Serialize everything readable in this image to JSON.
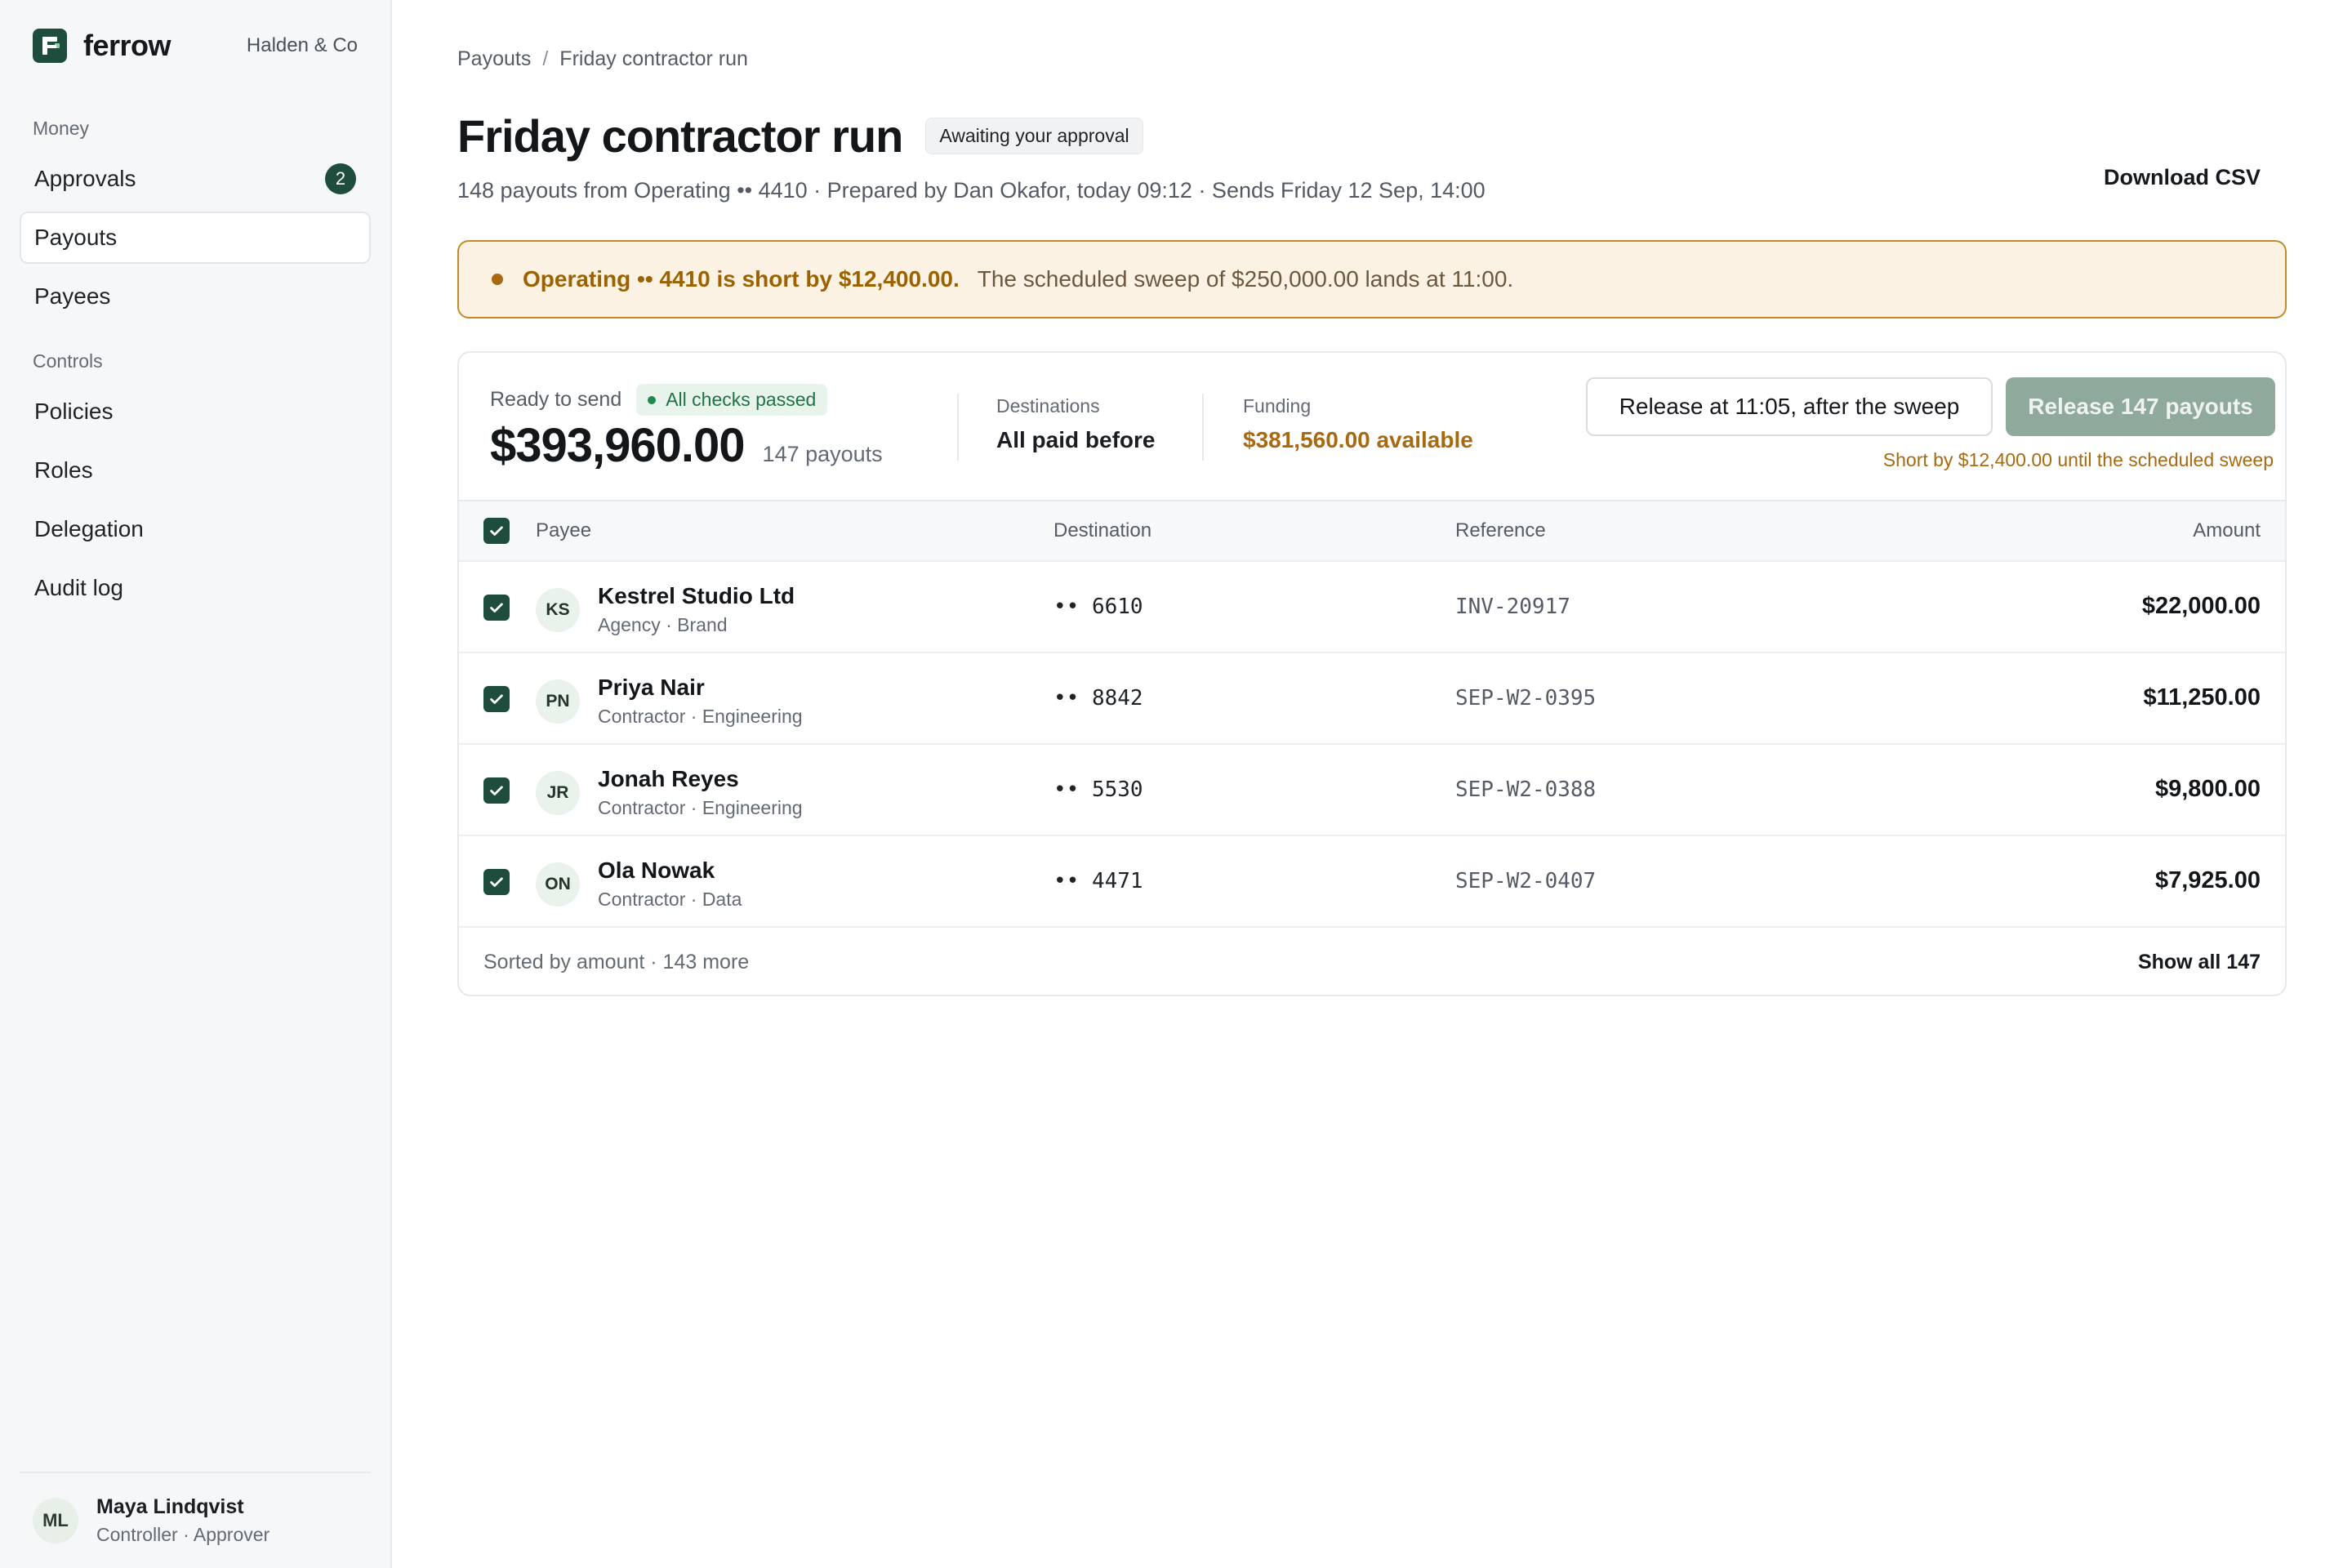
{
  "brand": {
    "name": "ferrow",
    "org": "Halden & Co",
    "logo_color": "#1f4d3d"
  },
  "sidebar": {
    "sections": [
      {
        "label": "Money",
        "items": [
          {
            "label": "Approvals",
            "badge": "2",
            "active": false
          },
          {
            "label": "Payouts",
            "active": true
          },
          {
            "label": "Payees",
            "active": false
          }
        ]
      },
      {
        "label": "Controls",
        "items": [
          {
            "label": "Policies"
          },
          {
            "label": "Roles"
          },
          {
            "label": "Delegation"
          },
          {
            "label": "Audit log"
          }
        ]
      }
    ],
    "user": {
      "initials": "ML",
      "name": "Maya Lindqvist",
      "role": "Controller · Approver"
    }
  },
  "breadcrumb": {
    "parent": "Payouts",
    "separator": "/",
    "current": "Friday contractor run"
  },
  "header": {
    "title": "Friday contractor run",
    "status": "Awaiting your approval",
    "subtitle": "148 payouts from Operating •• 4410 · Prepared by Dan Okafor, today 09:12 · Sends Friday 12 Sep, 14:00",
    "download_label": "Download CSV"
  },
  "alert": {
    "strong": "Operating •• 4410 is short by $12,400.00.",
    "text": "The scheduled sweep of $250,000.00 lands at 11:00."
  },
  "summary": {
    "ready_label": "Ready to send",
    "checks_label": "All checks passed",
    "total": "$393,960.00",
    "count": "147 payouts",
    "destinations": {
      "label": "Destinations",
      "value": "All paid before"
    },
    "funding": {
      "label": "Funding",
      "value": "$381,560.00 available"
    },
    "release_later_label": "Release at 11:05, after the sweep",
    "release_now_label": "Release 147 payouts",
    "short_note": "Short by $12,400.00 until the scheduled sweep"
  },
  "table": {
    "columns": {
      "payee": "Payee",
      "destination": "Destination",
      "reference": "Reference",
      "amount": "Amount"
    },
    "rows": [
      {
        "initials": "KS",
        "name": "Kestrel Studio Ltd",
        "sub": "Agency · Brand",
        "destination": "•• 6610",
        "reference": "INV-20917",
        "amount": "$22,000.00"
      },
      {
        "initials": "PN",
        "name": "Priya Nair",
        "sub": "Contractor · Engineering",
        "destination": "•• 8842",
        "reference": "SEP-W2-0395",
        "amount": "$11,250.00"
      },
      {
        "initials": "JR",
        "name": "Jonah Reyes",
        "sub": "Contractor · Engineering",
        "destination": "•• 5530",
        "reference": "SEP-W2-0388",
        "amount": "$9,800.00"
      },
      {
        "initials": "ON",
        "name": "Ola Nowak",
        "sub": "Contractor · Data",
        "destination": "•• 4471",
        "reference": "SEP-W2-0407",
        "amount": "$7,925.00"
      }
    ],
    "footer_note": "Sorted by amount · 143 more",
    "show_all_label": "Show all 147"
  }
}
